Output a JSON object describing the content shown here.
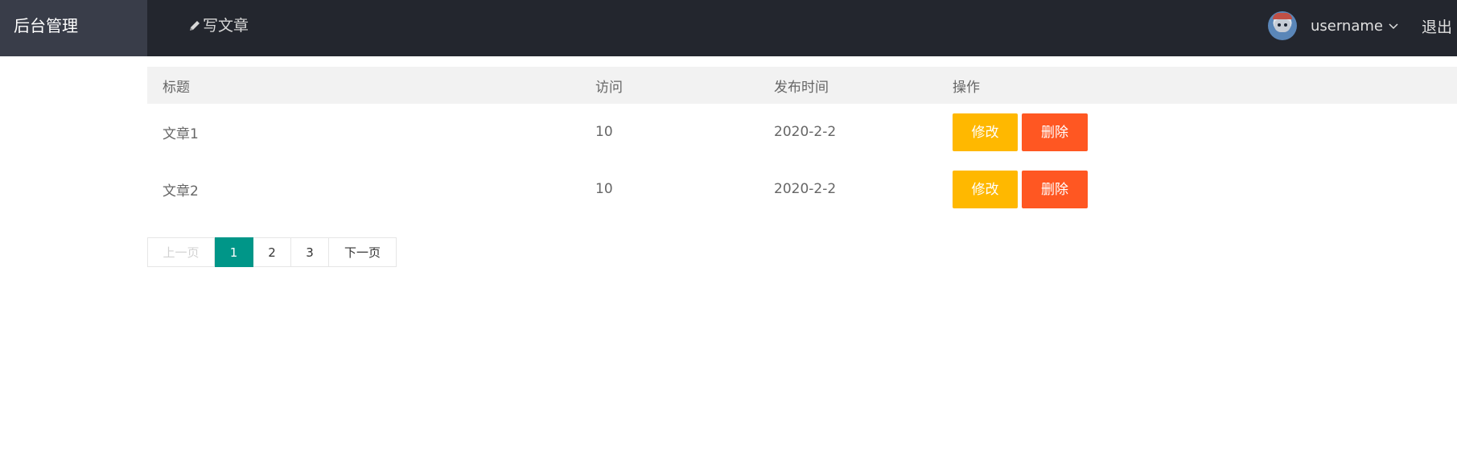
{
  "header": {
    "logo": "后台管理",
    "nav_write": "写文章",
    "username": "username",
    "logout": "退出"
  },
  "table": {
    "headers": {
      "title": "标题",
      "visits": "访问",
      "publish_time": "发布时间",
      "actions": "操作"
    },
    "rows": [
      {
        "title": "文章1",
        "visits": "10",
        "publish_time": "2020-2-2",
        "edit": "修改",
        "delete": "删除"
      },
      {
        "title": "文章2",
        "visits": "10",
        "publish_time": "2020-2-2",
        "edit": "修改",
        "delete": "删除"
      }
    ]
  },
  "pagination": {
    "prev": "上一页",
    "pages": [
      "1",
      "2",
      "3"
    ],
    "current": "1",
    "next": "下一页"
  },
  "colors": {
    "header_bg": "#23262e",
    "logo_bg": "#393d49",
    "edit_button": "#ffb800",
    "delete_button": "#ff5722",
    "current_page": "#009688"
  },
  "icons": {
    "write": "pencil-icon",
    "user_menu": "chevron-down-icon",
    "avatar": "avatar"
  }
}
